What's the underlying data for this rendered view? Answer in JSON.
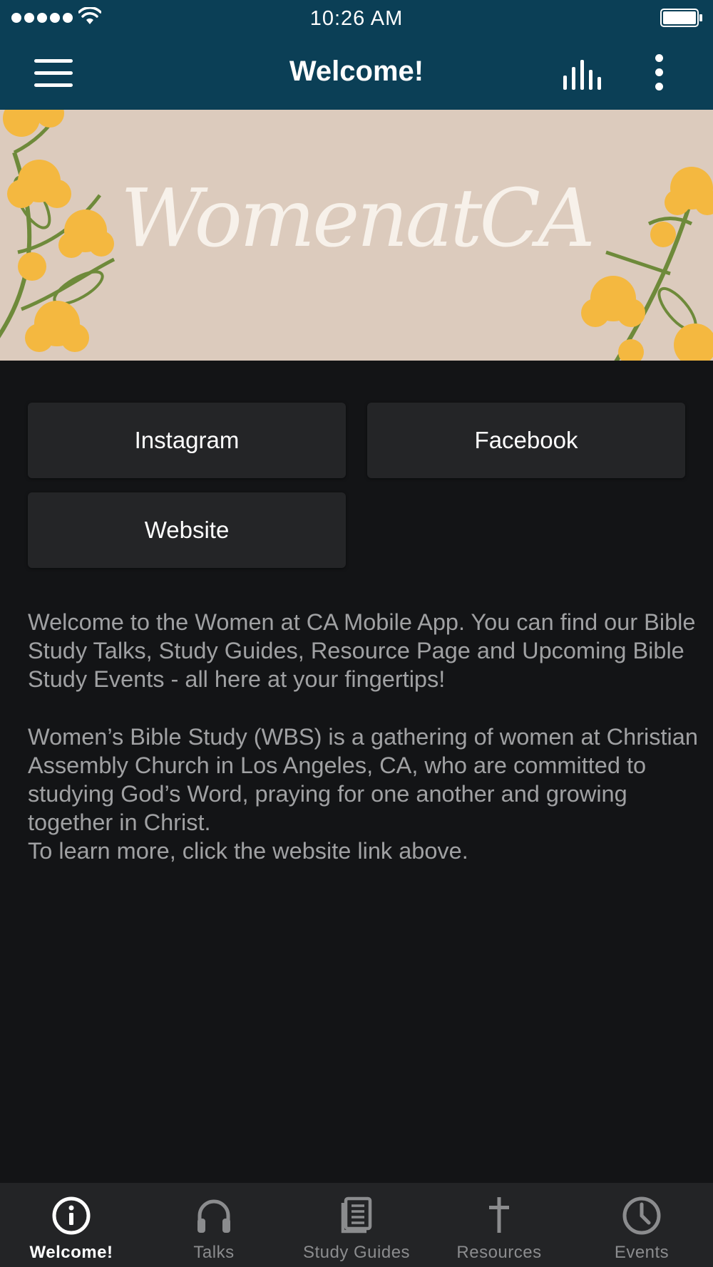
{
  "status_bar": {
    "time": "10:26 AM"
  },
  "nav": {
    "title": "Welcome!"
  },
  "banner": {
    "logo_text": "WomenatCA"
  },
  "links": {
    "instagram": "Instagram",
    "facebook": "Facebook",
    "website": "Website"
  },
  "content": {
    "paragraph_1": "Welcome to the Women at CA Mobile App.  You can find our Bible Study Talks, Study Guides, Resource Page and Upcoming Bible Study Events - all here at your fingertips!",
    "paragraph_2": "Women’s Bible Study (WBS) is a gathering of women at Christian Assembly Church in Los Angeles, CA, who are committed to studying God’s Word, praying for one another and growing together in Christ.",
    "paragraph_3": "To learn more, click the website link above."
  },
  "tabs": [
    {
      "label": "Welcome!",
      "icon": "info-icon",
      "active": true
    },
    {
      "label": "Talks",
      "icon": "headphones-icon",
      "active": false
    },
    {
      "label": "Study Guides",
      "icon": "book-icon",
      "active": false
    },
    {
      "label": "Resources",
      "icon": "cross-icon",
      "active": false
    },
    {
      "label": "Events",
      "icon": "clock-icon",
      "active": false
    }
  ],
  "colors": {
    "header": "#0b3f56",
    "background": "#131416",
    "button": "#242527",
    "tab_bar": "#232426",
    "banner": "#dccbbd",
    "flower": "#f4b840",
    "leaf": "#6e8a3a"
  }
}
